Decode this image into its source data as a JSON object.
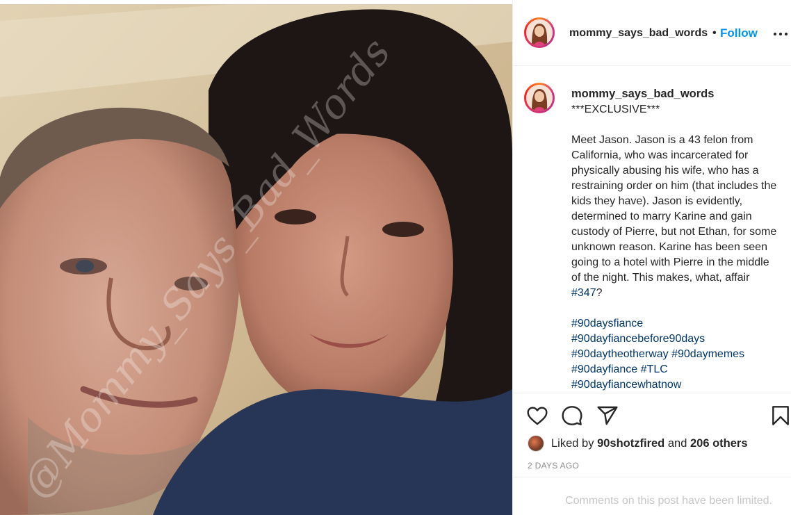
{
  "post": {
    "username": "mommy_says_bad_words",
    "separator": "•",
    "follow_label": "Follow",
    "more_options_icon": "more-horizontal-icon",
    "watermark": "@Mommy_Says_Bad_Words"
  },
  "caption": {
    "username": "mommy_says_bad_words",
    "headline": "***EXCLUSIVE***",
    "body": "Meet Jason. Jason is a 43 felon from California, who was incarcerated for physically abusing his wife, who has a restraining order on him (that includes the kids they have). Jason is evidently, determined to marry Karine and gain custody of Pierre, but not Ethan, for some unknown reason. Karine has been seen going to a hotel with Pierre in the middle of the night. This makes, what, affair ",
    "body_tag": "#347",
    "body_tail": "?",
    "hashtags": [
      "#90daysfiance",
      "#90dayfiancebefore90days",
      "#90daytheotherway",
      "#90daymemes",
      "#90dayfiance",
      "#TLC",
      "#90dayfiancewhatnow"
    ]
  },
  "actions": {
    "like_icon": "heart-icon",
    "comment_icon": "comment-icon",
    "share_icon": "send-icon",
    "save_icon": "bookmark-icon"
  },
  "likes": {
    "prefix": "Liked by ",
    "user": "90shotzfired",
    "middle": " and ",
    "others": "206 others"
  },
  "timestamp": "2 DAYS AGO",
  "comments_notice": "Comments on this post have been limited.",
  "colors": {
    "link": "#00376b",
    "follow": "#0095f6",
    "muted": "#8e8e8e",
    "border": "#efefef"
  }
}
